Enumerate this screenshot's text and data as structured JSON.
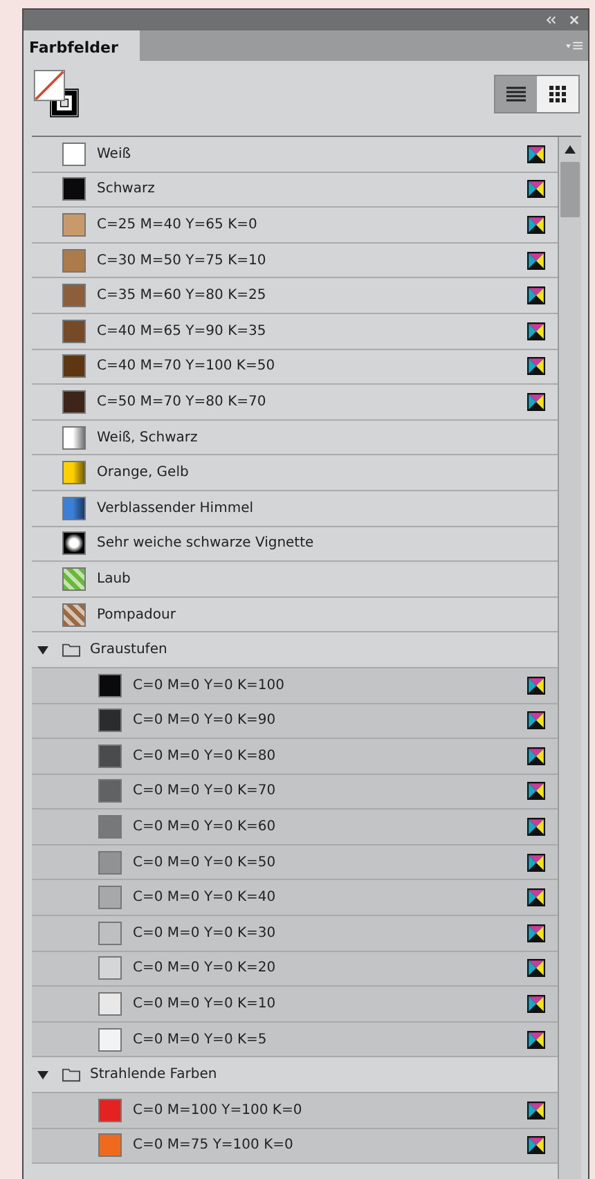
{
  "panel": {
    "tab": "Farbfelder",
    "view_buttons": [
      {
        "kind": "list",
        "selected": true
      },
      {
        "kind": "grid",
        "selected": false
      }
    ]
  },
  "swatches": [
    {
      "name": "Weiß",
      "kind": "solid",
      "color": "#ffffff",
      "process": true
    },
    {
      "name": "Schwarz",
      "kind": "solid",
      "color": "#0a0a0c",
      "process": true
    },
    {
      "name": "C=25 M=40 Y=65 K=0",
      "kind": "solid",
      "color": "#c8996a",
      "process": true
    },
    {
      "name": "C=30 M=50 Y=75 K=10",
      "kind": "solid",
      "color": "#ad7a4c",
      "process": true
    },
    {
      "name": "C=35 M=60 Y=80 K=25",
      "kind": "solid",
      "color": "#8c5e3b",
      "process": true
    },
    {
      "name": "C=40 M=65 Y=90 K=35",
      "kind": "solid",
      "color": "#764a26",
      "process": true
    },
    {
      "name": "C=40 M=70 Y=100 K=50",
      "kind": "solid",
      "color": "#5e3712",
      "process": true
    },
    {
      "name": "C=50 M=70 Y=80 K=70",
      "kind": "solid",
      "color": "#3e2519",
      "process": true
    },
    {
      "name": "Weiß, Schwarz",
      "kind": "gradient",
      "color": "#ffffff",
      "process": false
    },
    {
      "name": "Orange, Gelb",
      "kind": "gradient",
      "color": "#ffd000",
      "process": false
    },
    {
      "name": "Verblassender Himmel",
      "kind": "gradient",
      "color": "#3d7fd6",
      "process": false
    },
    {
      "name": "Sehr weiche schwarze Vignette",
      "kind": "radial",
      "color": "#000000",
      "process": false
    },
    {
      "name": "Laub",
      "kind": "pattern",
      "color": "#6ab83a",
      "process": false
    },
    {
      "name": "Pompadour",
      "kind": "pattern",
      "color": "#9a6a44",
      "process": false
    },
    {
      "name": "Graustufen",
      "kind": "group",
      "expanded": true,
      "children": [
        {
          "name": "C=0 M=0 Y=0 K=100",
          "kind": "solid",
          "color": "#0a0a0c",
          "process": true
        },
        {
          "name": "C=0 M=0 Y=0 K=90",
          "kind": "solid",
          "color": "#2b2c2e",
          "process": true
        },
        {
          "name": "C=0 M=0 Y=0 K=80",
          "kind": "solid",
          "color": "#4a4b4d",
          "process": true
        },
        {
          "name": "C=0 M=0 Y=0 K=70",
          "kind": "solid",
          "color": "#616264",
          "process": true
        },
        {
          "name": "C=0 M=0 Y=0 K=60",
          "kind": "solid",
          "color": "#777879",
          "process": true
        },
        {
          "name": "C=0 M=0 Y=0 K=50",
          "kind": "solid",
          "color": "#919293",
          "process": true
        },
        {
          "name": "C=0 M=0 Y=0 K=40",
          "kind": "solid",
          "color": "#a7a8a9",
          "process": true
        },
        {
          "name": "C=0 M=0 Y=0 K=30",
          "kind": "solid",
          "color": "#bebfc0",
          "process": true
        },
        {
          "name": "C=0 M=0 Y=0 K=20",
          "kind": "solid",
          "color": "#d5d6d7",
          "process": true
        },
        {
          "name": "C=0 M=0 Y=0 K=10",
          "kind": "solid",
          "color": "#e8e8e9",
          "process": true
        },
        {
          "name": "C=0 M=0 Y=0 K=5",
          "kind": "solid",
          "color": "#f3f3f3",
          "process": true
        }
      ]
    },
    {
      "name": "Strahlende Farben",
      "kind": "group",
      "expanded": true,
      "children": [
        {
          "name": "C=0 M=100 Y=100 K=0",
          "kind": "solid",
          "color": "#e52222",
          "process": true
        },
        {
          "name": "C=0 M=75 Y=100 K=0",
          "kind": "solid",
          "color": "#f06a1e",
          "process": true
        }
      ]
    }
  ]
}
